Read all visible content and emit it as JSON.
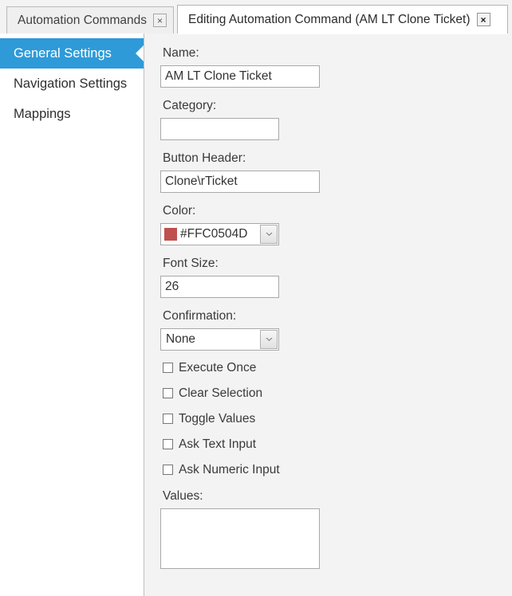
{
  "tabs": [
    {
      "label": "Automation Commands",
      "close_icon": "close-icon",
      "active": false
    },
    {
      "label": "Editing Automation Command (AM LT Clone Ticket)",
      "close_icon": "close-icon",
      "active": true
    }
  ],
  "close_glyph": "×",
  "sidebar": {
    "items": [
      {
        "label": "General Settings",
        "selected": true
      },
      {
        "label": "Navigation Settings",
        "selected": false
      },
      {
        "label": "Mappings",
        "selected": false
      }
    ],
    "selected_color": "#2E9AD8"
  },
  "form": {
    "name": {
      "label": "Name:",
      "value": "AM LT Clone Ticket",
      "placeholder": ""
    },
    "category": {
      "label": "Category:",
      "value": "",
      "placeholder": ""
    },
    "button_header": {
      "label": "Button Header:",
      "value": "Clone\\rTicket",
      "placeholder": ""
    },
    "color": {
      "label": "Color:",
      "value": "#FFC0504D",
      "swatch": "#C0504D",
      "dropdown_icon": "chevron-down-icon"
    },
    "font_size": {
      "label": "Font Size:",
      "value": "26",
      "placeholder": ""
    },
    "confirmation": {
      "label": "Confirmation:",
      "value": "None",
      "dropdown_icon": "chevron-down-icon"
    },
    "checkboxes": [
      {
        "label": "Execute Once",
        "checked": false
      },
      {
        "label": "Clear Selection",
        "checked": false
      },
      {
        "label": "Toggle Values",
        "checked": false
      },
      {
        "label": "Ask Text Input",
        "checked": false
      },
      {
        "label": "Ask Numeric Input",
        "checked": false
      }
    ],
    "values": {
      "label": "Values:",
      "value": "",
      "placeholder": ""
    }
  }
}
